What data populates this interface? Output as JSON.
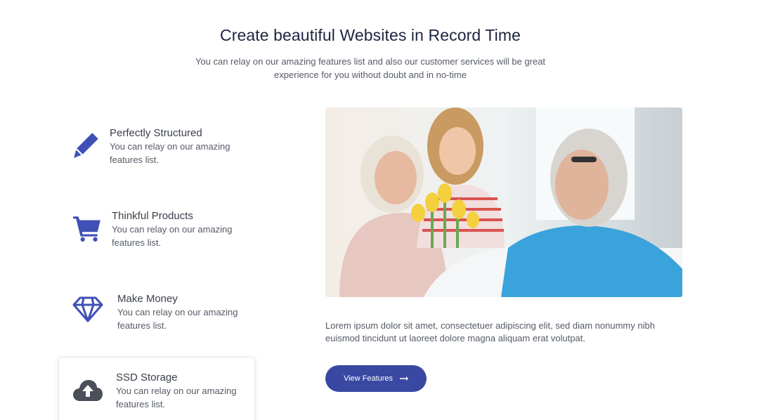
{
  "header": {
    "title": "Create beautiful Websites in Record Time",
    "subtitle": "You can relay on our amazing features list and also our customer services will be great experience for you without doubt and in no-time"
  },
  "features": [
    {
      "title": "Perfectly Structured",
      "description": "You can relay on our amazing features list.",
      "icon": "pencil-icon"
    },
    {
      "title": "Thinkful Products",
      "description": "You can relay on our amazing features list.",
      "icon": "shopping-cart-icon"
    },
    {
      "title": "Make Money",
      "description": "You can relay on our amazing features list.",
      "icon": "diamond-icon"
    },
    {
      "title": "SSD Storage",
      "description": "You can relay on our amazing features list.",
      "icon": "cloud-upload-icon"
    }
  ],
  "content": {
    "lorem": "Lorem ipsum dolor sit amet, consectetuer adipiscing elit, sed diam nonummy nibh euismod tincidunt ut laoreet dolore magna aliquam erat volutpat.",
    "button_label": "View Features"
  },
  "colors": {
    "accent": "#3949a1",
    "icon_blue": "#3f51b5",
    "icon_dark": "#4a4f5a",
    "title": "#1e2540"
  }
}
